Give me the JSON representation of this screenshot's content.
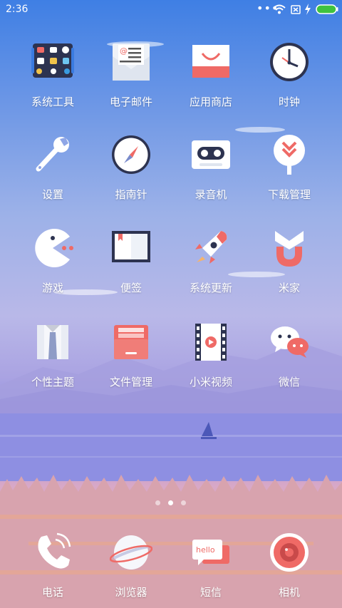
{
  "status": {
    "time": "2:36",
    "dots": "•••",
    "icons": [
      "signal-dots-icon",
      "wifi-icon",
      "no-sim-icon",
      "charging-bolt-icon",
      "battery-icon"
    ],
    "battery_color": "#3fc23f"
  },
  "home": {
    "rows": [
      [
        {
          "label": "系统工具",
          "icon": "tools-folder-icon"
        },
        {
          "label": "电子邮件",
          "icon": "email-icon"
        },
        {
          "label": "应用商店",
          "icon": "app-store-icon"
        },
        {
          "label": "时钟",
          "icon": "clock-icon"
        }
      ],
      [
        {
          "label": "设置",
          "icon": "settings-wrench-icon"
        },
        {
          "label": "指南针",
          "icon": "compass-icon"
        },
        {
          "label": "录音机",
          "icon": "recorder-icon"
        },
        {
          "label": "下载管理",
          "icon": "download-icon"
        }
      ],
      [
        {
          "label": "游戏",
          "icon": "game-icon"
        },
        {
          "label": "便签",
          "icon": "notes-icon"
        },
        {
          "label": "系统更新",
          "icon": "rocket-update-icon"
        },
        {
          "label": "米家",
          "icon": "mijia-icon"
        }
      ],
      [
        {
          "label": "个性主题",
          "icon": "themes-icon"
        },
        {
          "label": "文件管理",
          "icon": "file-manager-icon"
        },
        {
          "label": "小米视频",
          "icon": "video-icon"
        },
        {
          "label": "微信",
          "icon": "wechat-icon"
        }
      ]
    ],
    "page_count": 3,
    "current_page": 2
  },
  "dock": [
    {
      "label": "电话",
      "icon": "phone-icon"
    },
    {
      "label": "浏览器",
      "icon": "browser-icon"
    },
    {
      "label": "短信",
      "icon": "messages-icon",
      "icon_text": "hello"
    },
    {
      "label": "相机",
      "icon": "camera-icon"
    }
  ],
  "colors": {
    "accent_red": "#ef6a66",
    "sky_top": "#3f7fe4",
    "sea": "#8b8ee0"
  }
}
